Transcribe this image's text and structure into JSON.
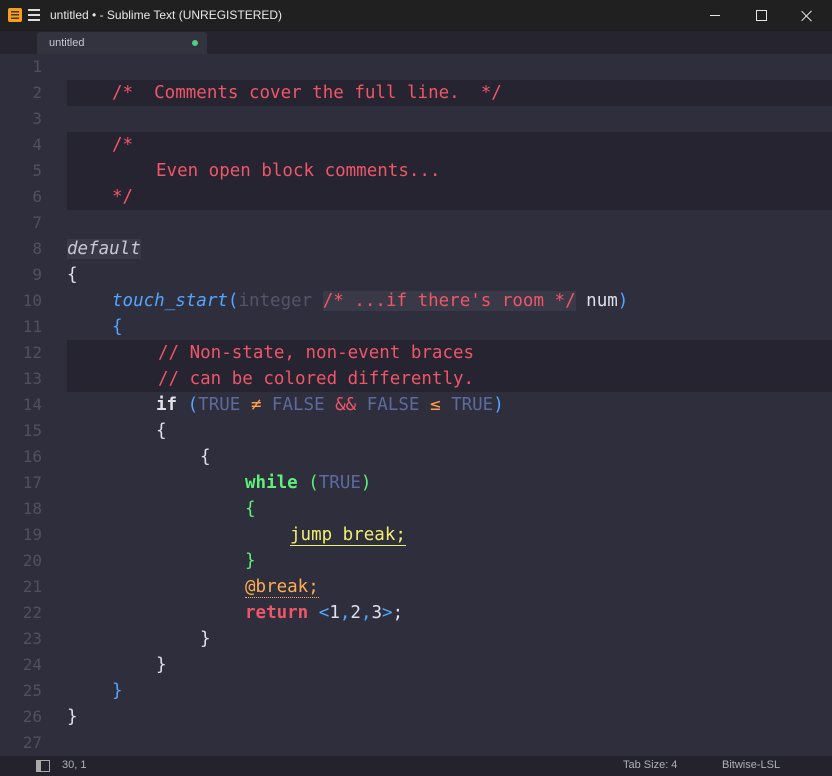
{
  "window": {
    "title": "untitled • - Sublime Text (UNREGISTERED)",
    "app_icon": "sublime-text-icon",
    "menu_icon": "hamburger-menu-icon"
  },
  "tabs": [
    {
      "label": "untitled",
      "dirty": true,
      "dirty_color": "#4fd07a"
    }
  ],
  "editor": {
    "line_numbers": [
      "1",
      "2",
      "3",
      "4",
      "5",
      "6",
      "7",
      "8",
      "9",
      "10",
      "11",
      "12",
      "13",
      "14",
      "15",
      "16",
      "17",
      "18",
      "19",
      "20",
      "21",
      "22",
      "23",
      "24",
      "25",
      "26",
      "27"
    ],
    "code": {
      "l2": "/*  Comments cover the full line.  */",
      "l4": "/*",
      "l5": "Even open block comments...",
      "l6": "*/",
      "l8": "default",
      "l9": "{",
      "l10_func": "touch_start",
      "l10_paren_open": "(",
      "l10_type": "integer ",
      "l10_comment": "/* ...if there's room */",
      "l10_param": " num",
      "l10_paren_close": ")",
      "l11": "{",
      "l12": "// Non-state, non-event braces",
      "l13": "// can be colored differently.",
      "l14_if": "if ",
      "l14_po": "(",
      "l14_true1": "TRUE",
      "l14_neq": " ≠ ",
      "l14_false1": "FALSE",
      "l14_and": " && ",
      "l14_false2": "FALSE",
      "l14_le": " ≤ ",
      "l14_true2": "TRUE",
      "l14_pc": ")",
      "l15": "{",
      "l16": "{",
      "l17_while": "while ",
      "l17_po": "(",
      "l17_true": "TRUE",
      "l17_pc": ")",
      "l18": "{",
      "l19": "jump break;",
      "l20": "}",
      "l21": "@break;",
      "l22_return": "return ",
      "l22_lt": "<",
      "l22_1": "1",
      "l22_c1": ",",
      "l22_2": "2",
      "l22_c2": ",",
      "l22_3": "3",
      "l22_gt": ">",
      "l22_semi": ";",
      "l23": "}",
      "l24": "}",
      "l25": "}",
      "l26": "}"
    }
  },
  "statusbar": {
    "panel_icon": "side-panel-toggle-icon",
    "cursor_position": "30, 1",
    "tab_size": "Tab Size: 4",
    "syntax": "Bitwise-LSL"
  }
}
